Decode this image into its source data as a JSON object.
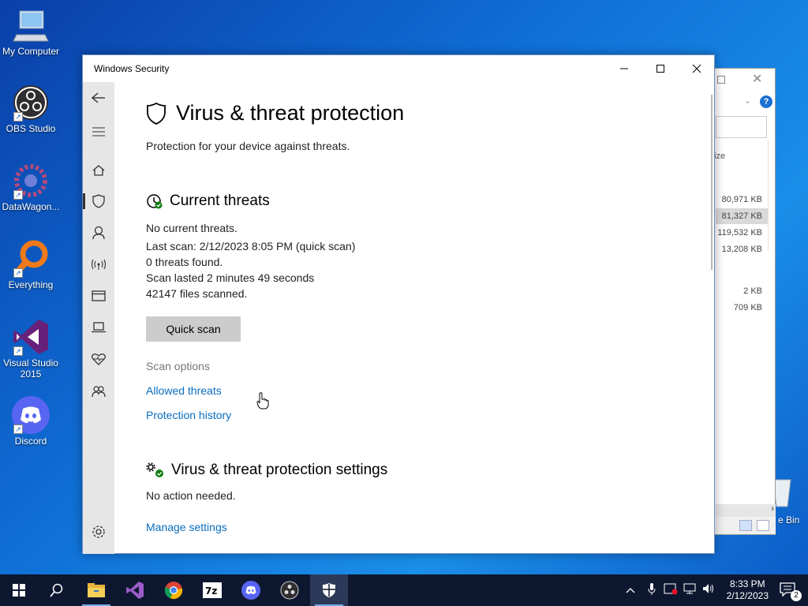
{
  "desktop": {
    "icons": [
      {
        "label": "My Computer"
      },
      {
        "label": "OBS Studio"
      },
      {
        "label": "DataWagon..."
      },
      {
        "label": "Everything"
      },
      {
        "label": "Visual Studio 2015"
      },
      {
        "label": "Discord"
      },
      {
        "label": "e Bin"
      }
    ]
  },
  "explorer_bg": {
    "column_header": "ize",
    "sizes": [
      "80,971 KB",
      "81,327 KB",
      "119,532 KB",
      "13,208 KB",
      "2 KB",
      "709 KB"
    ]
  },
  "window": {
    "title": "Windows Security",
    "page_title": "Virus & threat protection",
    "subtitle": "Protection for your device against threats.",
    "current_threats": {
      "heading": "Current threats",
      "lines": [
        "No current threats.",
        "Last scan: 2/12/2023 8:05 PM (quick scan)",
        "0 threats found.",
        "Scan lasted 2 minutes 49 seconds",
        "42147 files scanned."
      ],
      "quick_scan_label": "Quick scan",
      "scan_options_label": "Scan options",
      "allowed_threats_label": "Allowed threats",
      "protection_history_label": "Protection history"
    },
    "settings": {
      "heading": "Virus & threat protection settings",
      "status": "No action needed.",
      "manage_label": "Manage settings"
    },
    "colors": {
      "link": "#0a6dbf",
      "sidebar_bg": "#e6e6e6",
      "button_bg": "#cccccc"
    }
  },
  "taskbar": {
    "time": "8:33 PM",
    "date": "2/12/2023",
    "notification_count": "2",
    "apps": [
      "start-icon",
      "search-icon",
      "file-explorer-icon",
      "visual-studio-icon",
      "chrome-icon",
      "7zip-icon",
      "discord-icon",
      "obs-icon",
      "windows-security-icon"
    ]
  }
}
